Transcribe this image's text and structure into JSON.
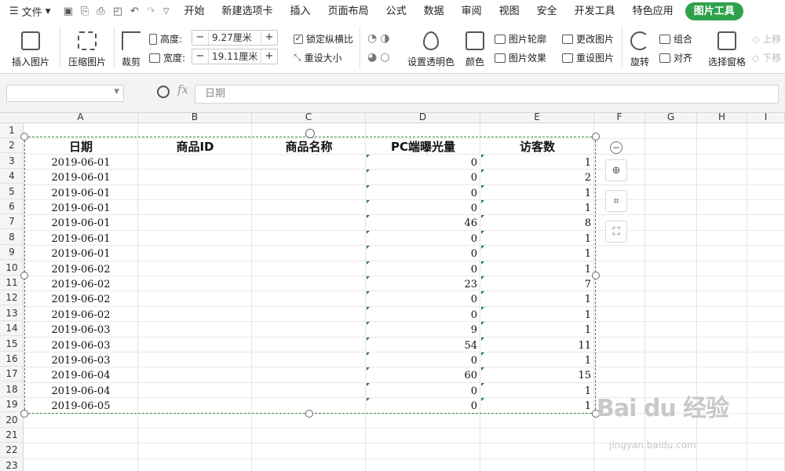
{
  "menubar": {
    "file_label": "文件",
    "tabs": [
      "开始",
      "新建选项卡",
      "插入",
      "页面布局",
      "公式",
      "数据",
      "审阅",
      "视图",
      "安全",
      "开发工具",
      "特色应用",
      "图片工具"
    ],
    "active_tab": "图片工具"
  },
  "ribbon": {
    "insert_picture": "插入图片",
    "compress_picture": "压缩图片",
    "crop": "裁剪",
    "height_label": "高度:",
    "height_value": "9.27厘米",
    "width_label": "宽度:",
    "width_value": "19.11厘米",
    "lock_ratio": "锁定纵横比",
    "reset_size": "重设大小",
    "set_transparent": "设置透明色",
    "color": "颜色",
    "picture_outline": "图片轮廓",
    "picture_effect": "图片效果",
    "change_picture": "更改图片",
    "reset_picture": "重设图片",
    "rotate": "旋转",
    "group": "组合",
    "align": "对齐",
    "selection_pane": "选择窗格",
    "bring_forward": "上移",
    "send_backward": "下移",
    "minus": "−",
    "plus": "+"
  },
  "formula_bar": {
    "fx": "fx",
    "content": "日期"
  },
  "grid": {
    "columns": [
      "A",
      "B",
      "C",
      "D",
      "E",
      "F",
      "G",
      "H",
      "I"
    ],
    "rows": [
      "1",
      "2",
      "3",
      "4",
      "5",
      "6",
      "7",
      "8",
      "9",
      "10",
      "11",
      "12",
      "13",
      "14",
      "15",
      "16",
      "17",
      "18",
      "19",
      "20",
      "21",
      "22",
      "23"
    ],
    "headers": [
      "日期",
      "商品ID",
      "商品名称",
      "PC端曝光量",
      "访客数"
    ],
    "data": [
      [
        "2019-06-01",
        "",
        "",
        "0",
        "1"
      ],
      [
        "2019-06-01",
        "",
        "",
        "0",
        "2"
      ],
      [
        "2019-06-01",
        "",
        "",
        "0",
        "1"
      ],
      [
        "2019-06-01",
        "",
        "",
        "0",
        "1"
      ],
      [
        "2019-06-01",
        "",
        "",
        "46",
        "8"
      ],
      [
        "2019-06-01",
        "",
        "",
        "0",
        "1"
      ],
      [
        "2019-06-01",
        "",
        "",
        "0",
        "1"
      ],
      [
        "2019-06-02",
        "",
        "",
        "0",
        "1"
      ],
      [
        "2019-06-02",
        "",
        "",
        "23",
        "7"
      ],
      [
        "2019-06-02",
        "",
        "",
        "0",
        "1"
      ],
      [
        "2019-06-02",
        "",
        "",
        "0",
        "1"
      ],
      [
        "2019-06-03",
        "",
        "",
        "9",
        "1"
      ],
      [
        "2019-06-03",
        "",
        "",
        "54",
        "11"
      ],
      [
        "2019-06-03",
        "",
        "",
        "0",
        "1"
      ],
      [
        "2019-06-04",
        "",
        "",
        "60",
        "15"
      ],
      [
        "2019-06-04",
        "",
        "",
        "0",
        "1"
      ],
      [
        "2019-06-05",
        "",
        "",
        "0",
        "1"
      ]
    ]
  },
  "watermark": {
    "main": "Bai du 经验",
    "url": "jingyan.baidu.com"
  }
}
